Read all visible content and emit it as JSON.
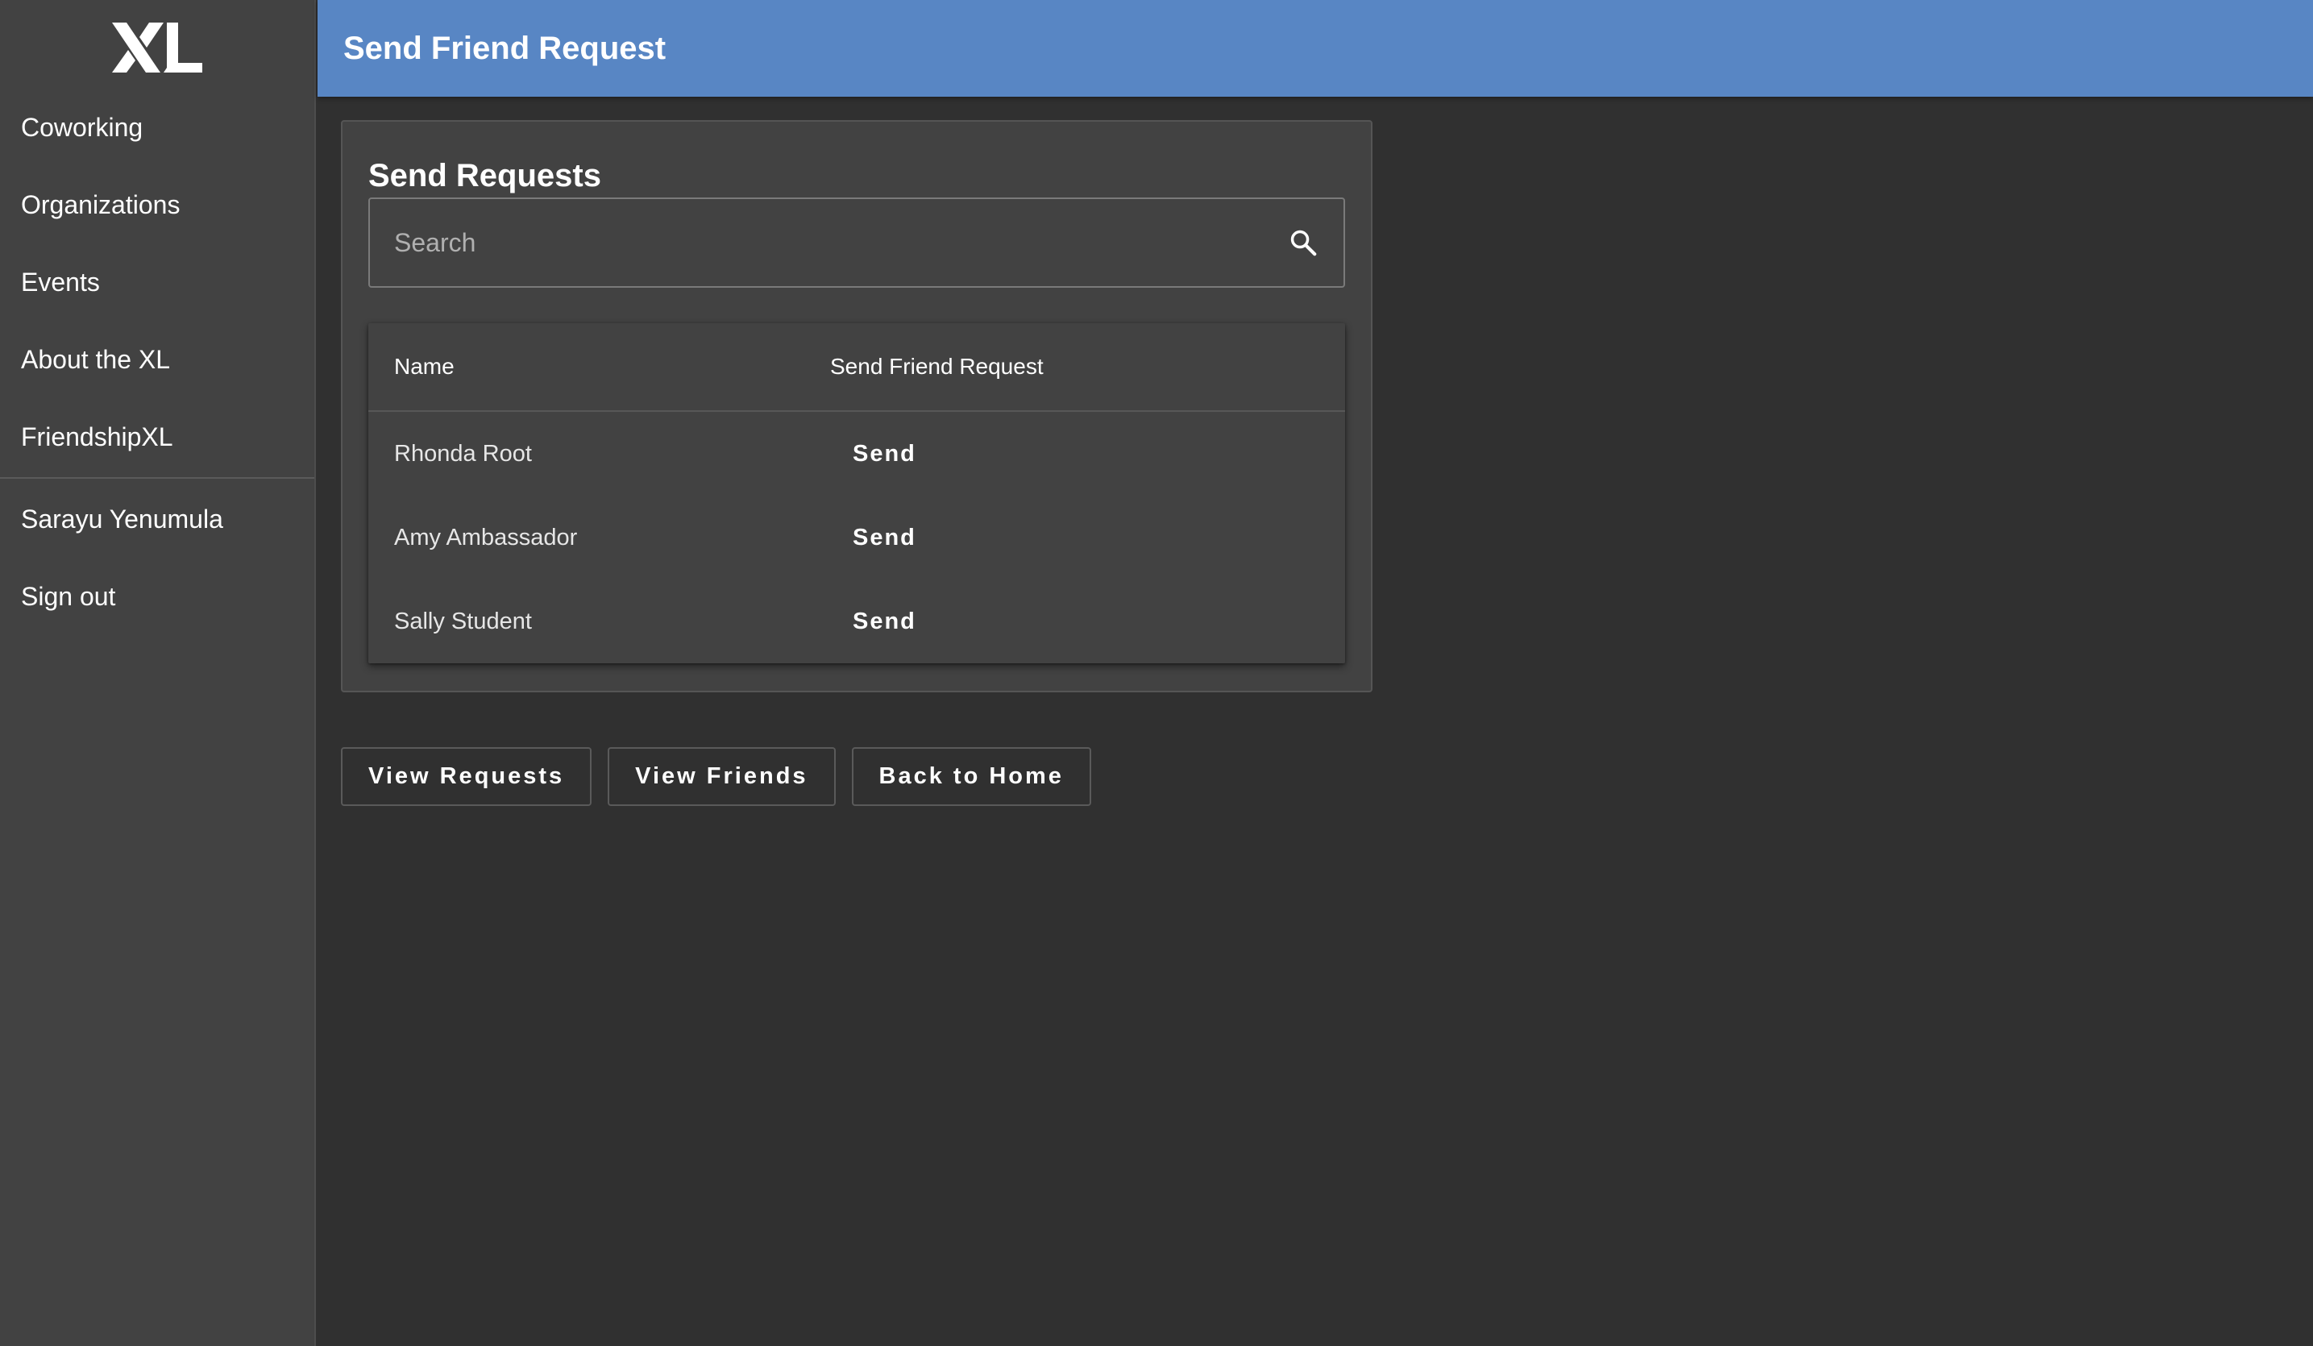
{
  "app": {
    "logo_text": "XL"
  },
  "sidebar": {
    "items": [
      {
        "label": "Coworking"
      },
      {
        "label": "Organizations"
      },
      {
        "label": "Events"
      },
      {
        "label": "About the XL"
      },
      {
        "label": "FriendshipXL"
      }
    ],
    "user_items": [
      {
        "label": "Sarayu Yenumula"
      },
      {
        "label": "Sign out"
      }
    ]
  },
  "header": {
    "title": "Send Friend Request"
  },
  "card": {
    "title": "Send Requests",
    "search": {
      "placeholder": "Search",
      "value": "",
      "icon": "search-icon"
    },
    "table": {
      "columns": [
        "Name",
        "Send Friend Request"
      ],
      "rows": [
        {
          "name": "Rhonda Root",
          "action": "Send"
        },
        {
          "name": "Amy Ambassador",
          "action": "Send"
        },
        {
          "name": "Sally Student",
          "action": "Send"
        }
      ]
    }
  },
  "actions": {
    "view_requests": "View Requests",
    "view_friends": "View Friends",
    "back_home": "Back to Home"
  },
  "colors": {
    "header": "#5886c4",
    "sidebar": "#424242",
    "background": "#303030",
    "card": "#424242"
  }
}
